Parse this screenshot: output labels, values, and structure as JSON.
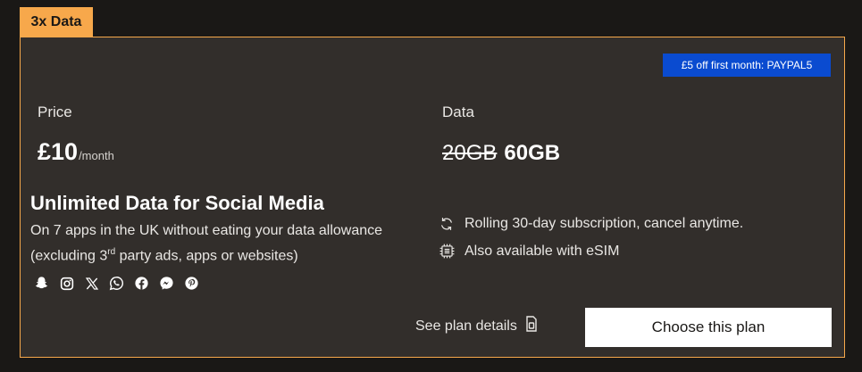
{
  "tag": "3x Data",
  "promo": "£5 off first month: PAYPAL5",
  "price": {
    "label": "Price",
    "amount": "£10",
    "unit": "/month"
  },
  "data": {
    "label": "Data",
    "old": "20GB",
    "new": "60GB"
  },
  "social": {
    "title": "Unlimited Data for Social Media",
    "desc_line1": "On 7 apps in the UK without eating your data allowance",
    "desc_prefix": "(excluding 3",
    "desc_sup": "rd",
    "desc_suffix": " party ads, apps or websites)",
    "icons": [
      "snapchat-icon",
      "instagram-icon",
      "x-icon",
      "whatsapp-icon",
      "facebook-icon",
      "messenger-icon",
      "pinterest-icon"
    ]
  },
  "features": [
    {
      "icon": "refresh-icon",
      "text": "Rolling 30-day subscription, cancel anytime."
    },
    {
      "icon": "esim-chip-icon",
      "text": "Also available with eSIM"
    }
  ],
  "actions": {
    "details": "See plan details",
    "choose": "Choose this plan"
  },
  "colors": {
    "accent": "#f7a84b",
    "promo": "#0a4bd0",
    "card": "#322e2b",
    "background": "#1a1816"
  }
}
